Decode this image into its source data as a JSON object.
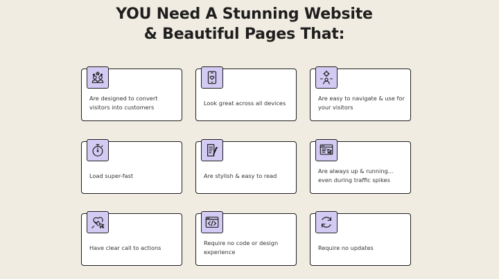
{
  "heading": {
    "line1": "YOU Need A Stunning Website",
    "line2": "& Beautiful Pages That:"
  },
  "colors": {
    "background": "#f1ece1",
    "icon_tile": "#d3cbf3",
    "border": "#1e1e1e"
  },
  "features": [
    {
      "text": "Are designed to convert visitors into customers",
      "icon": "people-stars-icon"
    },
    {
      "text": "Look great across all devices",
      "icon": "mobile-heart-icon"
    },
    {
      "text": "Are easy to navigate & use for your visitors",
      "icon": "user-navigation-icon"
    },
    {
      "text": "Load super-fast",
      "icon": "stopwatch-icon"
    },
    {
      "text": "Are stylish & easy to read",
      "icon": "document-pen-icon"
    },
    {
      "text": "Are always up & running... even during traffic spikes",
      "icon": "browser-cursor-icon"
    },
    {
      "text": "Have clear call to actions",
      "icon": "heart-click-icon"
    },
    {
      "text": "Require no code or design experience",
      "icon": "code-window-icon"
    },
    {
      "text": "Require no updates",
      "icon": "refresh-icon"
    }
  ]
}
